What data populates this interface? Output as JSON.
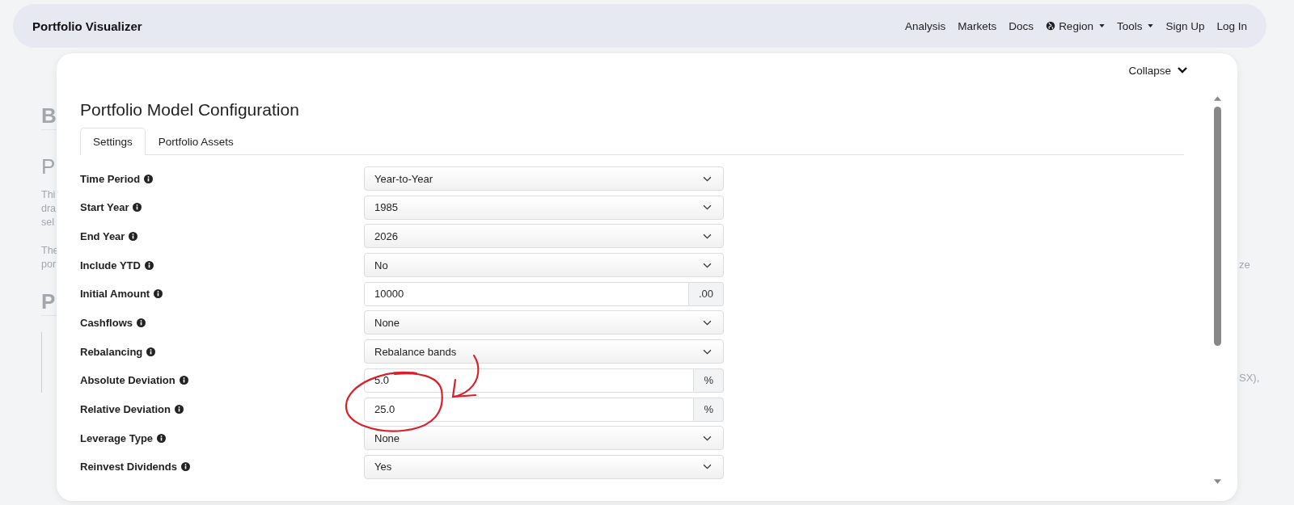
{
  "navbar": {
    "brand": "Portfolio Visualizer",
    "links": [
      {
        "label": "Analysis",
        "kind": "link"
      },
      {
        "label": "Markets",
        "kind": "link"
      },
      {
        "label": "Docs",
        "kind": "link"
      },
      {
        "label": "Region",
        "kind": "globe-dropdown"
      },
      {
        "label": "Tools",
        "kind": "dropdown"
      },
      {
        "label": "Sign Up",
        "kind": "link"
      },
      {
        "label": "Log In",
        "kind": "link"
      }
    ]
  },
  "background": {
    "left_fragments": [
      {
        "text": "B",
        "kind": "heading"
      },
      {
        "text": "P",
        "kind": "subheading"
      },
      {
        "text": "Thi",
        "kind": "line"
      },
      {
        "text": "dra",
        "kind": "line"
      },
      {
        "text": "sel",
        "kind": "line-end"
      },
      {
        "text": "The",
        "kind": "line"
      },
      {
        "text": "por",
        "kind": "line-end"
      },
      {
        "text": "P",
        "kind": "heading"
      }
    ],
    "right_fragments": [
      {
        "text": "ze"
      },
      {
        "text": "SX),"
      }
    ]
  },
  "modal": {
    "collapse": "Collapse",
    "title": "Portfolio Model Configuration",
    "tabs": [
      {
        "label": "Settings",
        "selected": true
      },
      {
        "label": "Portfolio Assets",
        "selected": false
      }
    ],
    "fields": [
      {
        "label": "Time Period",
        "kind": "select",
        "value": "Year-to-Year"
      },
      {
        "label": "Start Year",
        "kind": "select",
        "value": "1985"
      },
      {
        "label": "End Year",
        "kind": "select",
        "value": "2026"
      },
      {
        "label": "Include YTD",
        "kind": "select",
        "value": "No"
      },
      {
        "label": "Initial Amount",
        "kind": "input",
        "value": "10000",
        "suffix": ".00"
      },
      {
        "label": "Cashflows",
        "kind": "select",
        "value": "None"
      },
      {
        "label": "Rebalancing",
        "kind": "select",
        "value": "Rebalance bands"
      },
      {
        "label": "Absolute Deviation",
        "kind": "input",
        "value": "5.0",
        "suffix": "%"
      },
      {
        "label": "Relative Deviation",
        "kind": "input",
        "value": "25.0",
        "suffix": "%"
      },
      {
        "label": "Leverage Type",
        "kind": "select",
        "value": "None"
      },
      {
        "label": "Reinvest Dividends",
        "kind": "select",
        "value": "Yes"
      }
    ]
  }
}
